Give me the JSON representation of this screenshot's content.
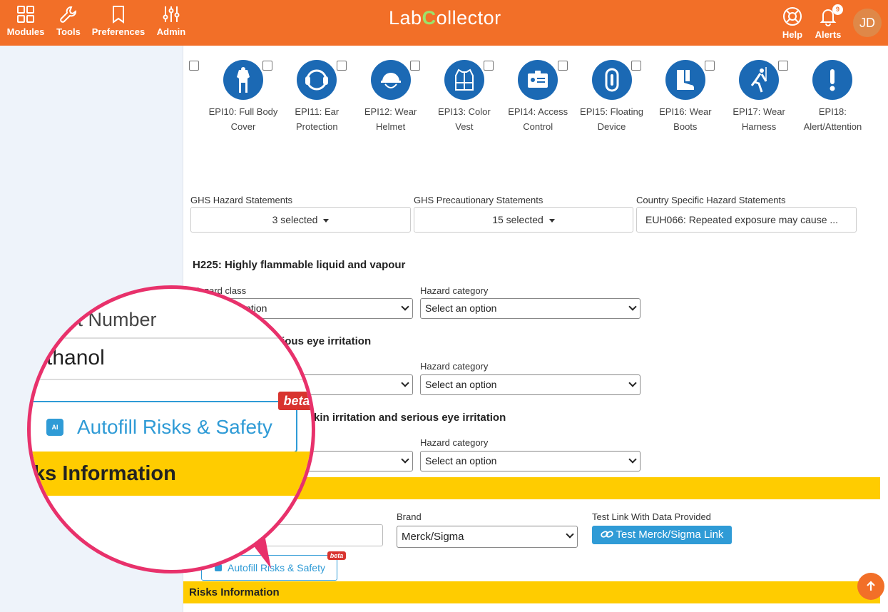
{
  "nav": {
    "modules": "Modules",
    "tools": "Tools",
    "preferences": "Preferences",
    "admin": "Admin",
    "help": "Help",
    "alerts": "Alerts",
    "alert_count": "9",
    "avatar": "JD"
  },
  "logo": {
    "part1": "Lab",
    "c": "C",
    "part2": "ollector"
  },
  "epi": [
    {
      "label": "EPI10: Full Body Cover",
      "icon": "full-body-cover-icon"
    },
    {
      "label": "EPI11: Ear Protection",
      "icon": "ear-protection-icon"
    },
    {
      "label": "EPI12: Wear Helmet",
      "icon": "helmet-icon"
    },
    {
      "label": "EPI13: Color Vest",
      "icon": "color-vest-icon"
    },
    {
      "label": "EPI14: Access Control",
      "icon": "access-control-icon"
    },
    {
      "label": "EPI15: Floating Device",
      "icon": "floating-device-icon"
    },
    {
      "label": "EPI16: Wear Boots",
      "icon": "boots-icon"
    },
    {
      "label": "EPI17: Wear Harness",
      "icon": "harness-icon"
    },
    {
      "label": "EPI18: Alert/Attention",
      "icon": "alert-attention-icon"
    }
  ],
  "ghs": {
    "hazard_label": "GHS Hazard Statements",
    "hazard_value": "3 selected",
    "precaution_label": "GHS Precautionary Statements",
    "precaution_value": "15 selected",
    "country_label": "Country Specific Hazard Statements",
    "country_value": "EUH066: Repeated exposure may cause ..."
  },
  "statements": [
    {
      "title": "H225: Highly flammable liquid and vapour",
      "class_label": "Hazard class",
      "class_value": "Select an option",
      "cat_label": "Hazard category",
      "cat_value": "Select an option"
    },
    {
      "title": "ious eye irritation",
      "class_label": "",
      "class_value": "",
      "cat_label": "Hazard category",
      "cat_value": "Select an option"
    },
    {
      "title": "kin irritation and serious eye irritation",
      "class_label": "",
      "class_value": "",
      "cat_label": "Hazard category",
      "cat_value": "Select an option"
    }
  ],
  "supplier": {
    "brand_label": "Brand",
    "brand_value": "Merck/Sigma",
    "test_label": "Test Link With Data Provided",
    "test_button": "Test Merck/Sigma Link"
  },
  "autofill": {
    "label": "Autofill Risks & Safety",
    "beta": "beta"
  },
  "risks_header": "Risks Information",
  "zoom": {
    "product_number": "ct Number",
    "name_value": "thanol",
    "autofill": "Autofill Risks & Safety",
    "ai": "AI",
    "beta": "beta",
    "risks": "ks Information"
  },
  "colors": {
    "brand_orange": "#f26f28",
    "accent_blue": "#2f9bd6",
    "section_yellow": "#ffcc00",
    "epi_blue": "#1b69b4",
    "lens_pink": "#e8316b"
  }
}
